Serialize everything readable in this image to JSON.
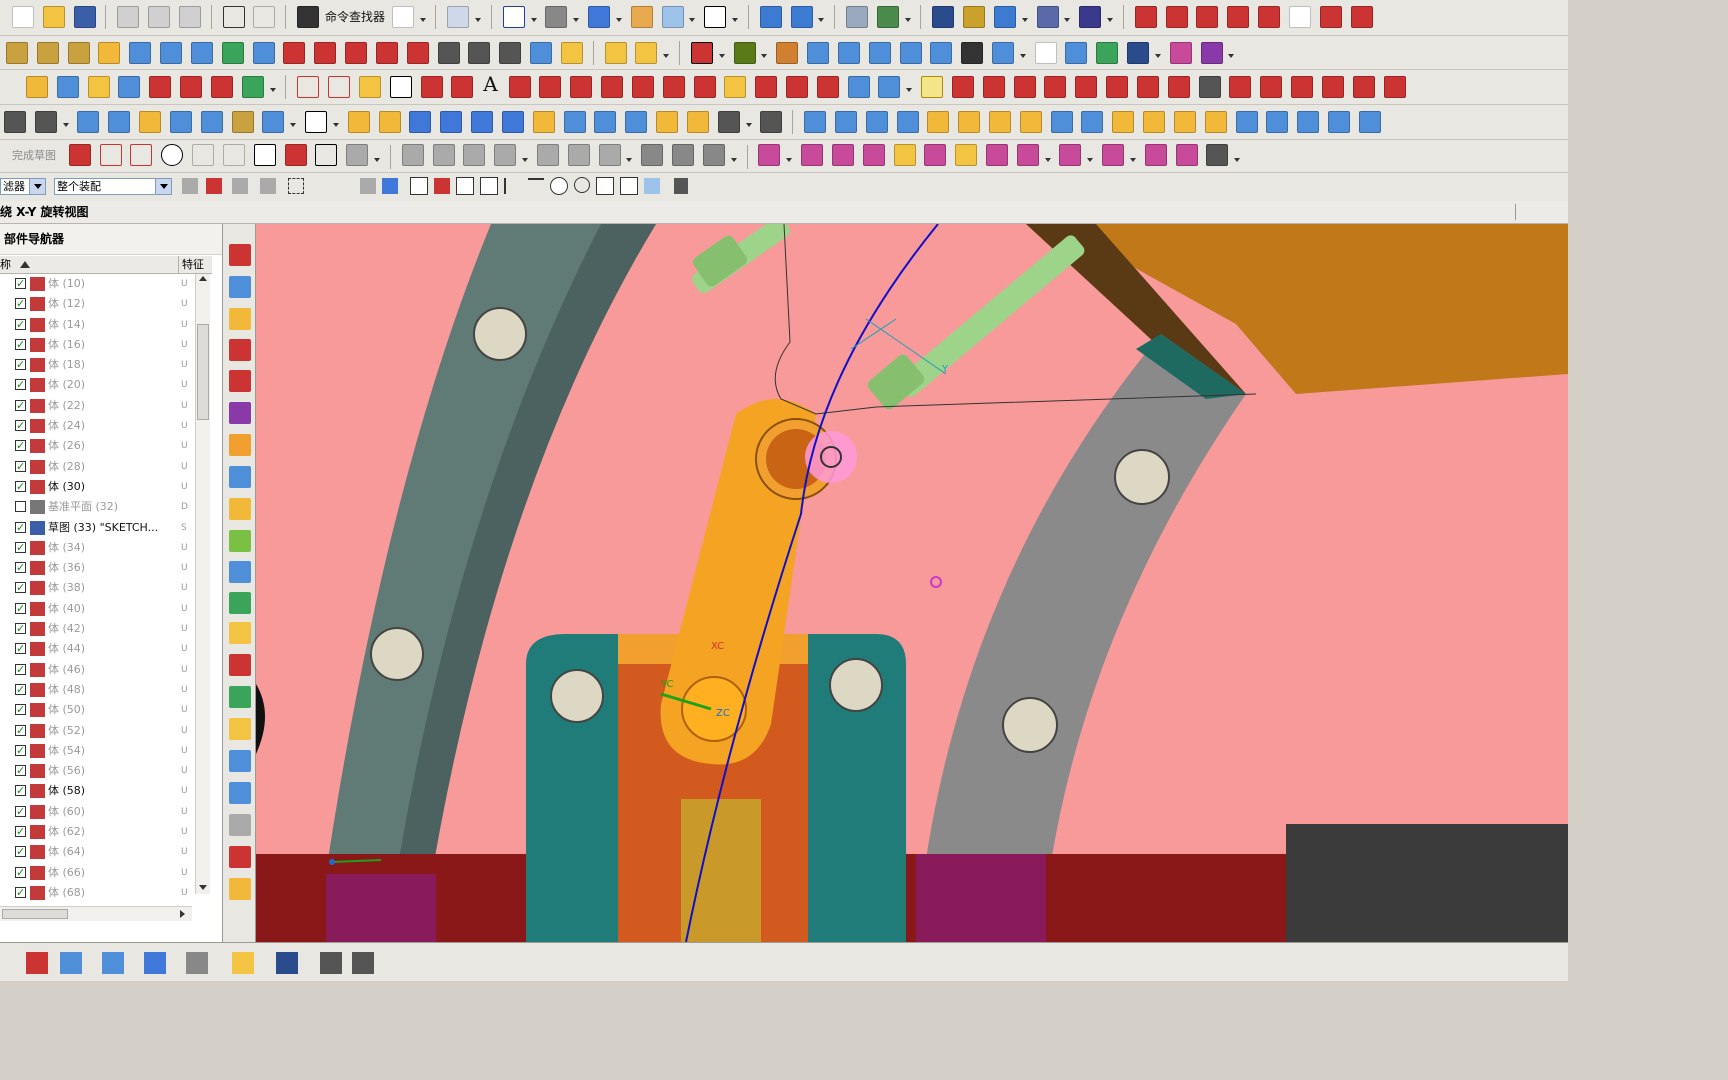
{
  "toolbar": {
    "command_finder_label": "命令查找器",
    "finish_sketch_label": "完成草图"
  },
  "selection_bar": {
    "filter_label": "滤器",
    "assembly_scope": "整个装配"
  },
  "view_title": "绕 X-Y 旋转视图",
  "navigator": {
    "title": "部件导航器",
    "col_name": "称",
    "col_feature": "特征",
    "rows": [
      {
        "label": "体 (10)",
        "checked": true,
        "icon": "body-icon",
        "type": "U",
        "active": false
      },
      {
        "label": "体 (12)",
        "checked": true,
        "icon": "body-icon",
        "type": "U",
        "active": false
      },
      {
        "label": "体 (14)",
        "checked": true,
        "icon": "body-icon",
        "type": "U",
        "active": false
      },
      {
        "label": "体 (16)",
        "checked": true,
        "icon": "body-icon",
        "type": "U",
        "active": false
      },
      {
        "label": "体 (18)",
        "checked": true,
        "icon": "body-icon",
        "type": "U",
        "active": false
      },
      {
        "label": "体 (20)",
        "checked": true,
        "icon": "body-icon",
        "type": "U",
        "active": false
      },
      {
        "label": "体 (22)",
        "checked": true,
        "icon": "body-icon",
        "type": "U",
        "active": false
      },
      {
        "label": "体 (24)",
        "checked": true,
        "icon": "body-icon",
        "type": "U",
        "active": false
      },
      {
        "label": "体 (26)",
        "checked": true,
        "icon": "body-icon",
        "type": "U",
        "active": false
      },
      {
        "label": "体 (28)",
        "checked": true,
        "icon": "body-icon",
        "type": "U",
        "active": false
      },
      {
        "label": "体 (30)",
        "checked": true,
        "icon": "body-icon",
        "type": "U",
        "active": true
      },
      {
        "label": "基准平面 (32)",
        "checked": false,
        "icon": "datum-plane-icon",
        "type": "D",
        "active": false
      },
      {
        "label": "草图 (33) \"SKETCH...",
        "checked": true,
        "icon": "sketch-icon",
        "type": "S",
        "active": true
      },
      {
        "label": "体 (34)",
        "checked": true,
        "icon": "body-icon",
        "type": "U",
        "active": false
      },
      {
        "label": "体 (36)",
        "checked": true,
        "icon": "body-icon",
        "type": "U",
        "active": false
      },
      {
        "label": "体 (38)",
        "checked": true,
        "icon": "body-icon",
        "type": "U",
        "active": false
      },
      {
        "label": "体 (40)",
        "checked": true,
        "icon": "body-icon",
        "type": "U",
        "active": false
      },
      {
        "label": "体 (42)",
        "checked": true,
        "icon": "body-icon",
        "type": "U",
        "active": false
      },
      {
        "label": "体 (44)",
        "checked": true,
        "icon": "body-icon",
        "type": "U",
        "active": false
      },
      {
        "label": "体 (46)",
        "checked": true,
        "icon": "body-icon",
        "type": "U",
        "active": false
      },
      {
        "label": "体 (48)",
        "checked": true,
        "icon": "body-icon",
        "type": "U",
        "active": false
      },
      {
        "label": "体 (50)",
        "checked": true,
        "icon": "body-icon",
        "type": "U",
        "active": false
      },
      {
        "label": "体 (52)",
        "checked": true,
        "icon": "body-icon",
        "type": "U",
        "active": false
      },
      {
        "label": "体 (54)",
        "checked": true,
        "icon": "body-icon",
        "type": "U",
        "active": false
      },
      {
        "label": "体 (56)",
        "checked": true,
        "icon": "body-icon",
        "type": "U",
        "active": false
      },
      {
        "label": "体 (58)",
        "checked": true,
        "icon": "body-icon",
        "type": "U",
        "active": true
      },
      {
        "label": "体 (60)",
        "checked": true,
        "icon": "body-icon",
        "type": "U",
        "active": false
      },
      {
        "label": "体 (62)",
        "checked": true,
        "icon": "body-icon",
        "type": "U",
        "active": false
      },
      {
        "label": "体 (64)",
        "checked": true,
        "icon": "body-icon",
        "type": "U",
        "active": false
      },
      {
        "label": "体 (66)",
        "checked": true,
        "icon": "body-icon",
        "type": "U",
        "active": false
      },
      {
        "label": "体 (68)",
        "checked": true,
        "icon": "body-icon",
        "type": "U",
        "active": false
      }
    ]
  },
  "viewport": {
    "background_color": "#f89a9a",
    "wcs_labels": [
      "XC",
      "YC",
      "ZC"
    ],
    "sketch_axis_label": "Y"
  },
  "colors": {
    "plate": "#f89a9a",
    "rail": "#607a76",
    "rail_gray": "#8a8a8a",
    "link": "#f5a323",
    "block": "#d35a1e",
    "clamp": "#1f7c78",
    "pin": "#9ed38a",
    "curve": "#1010c8",
    "base": "#8a1818",
    "dark": "#3b3b3b",
    "brown": "#c07818"
  }
}
